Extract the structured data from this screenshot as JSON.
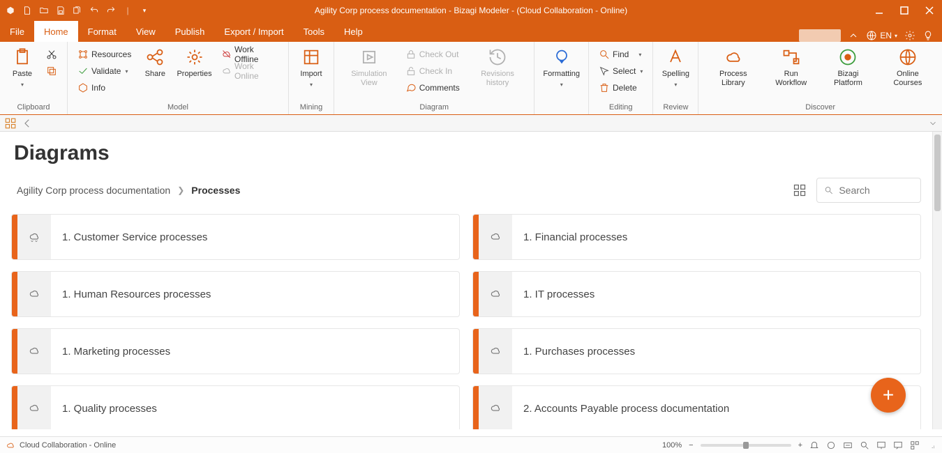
{
  "title": "Agility Corp process documentation - Bizagi Modeler - (Cloud Collaboration - Online)",
  "language": "EN",
  "tabs": {
    "file": "File",
    "home": "Home",
    "format": "Format",
    "view": "View",
    "publish": "Publish",
    "export": "Export / Import",
    "tools": "Tools",
    "help": "Help"
  },
  "ribbon": {
    "clipboard": {
      "paste": "Paste",
      "label": "Clipboard"
    },
    "model": {
      "resources": "Resources",
      "validate": "Validate",
      "info": "Info",
      "share": "Share",
      "properties": "Properties",
      "work_offline": "Work Offline",
      "work_online": "Work Online",
      "label": "Model"
    },
    "mining": {
      "import": "Import",
      "label": "Mining"
    },
    "diagram": {
      "simulation": "Simulation View",
      "checkout": "Check Out",
      "checkin": "Check In",
      "comments": "Comments",
      "history": "Revisions history",
      "label": "Diagram"
    },
    "formatting": {
      "formatting": "Formatting",
      "label": ""
    },
    "editing": {
      "find": "Find",
      "select": "Select",
      "delete": "Delete",
      "label": "Editing"
    },
    "review": {
      "spelling": "Spelling",
      "label": "Review"
    },
    "discover": {
      "library": "Process Library",
      "workflow": "Run Workflow",
      "platform": "Bizagi Platform",
      "courses": "Online Courses",
      "label": "Discover"
    }
  },
  "page": {
    "heading": "Diagrams",
    "breadcrumb_root": "Agility Corp process documentation",
    "breadcrumb_current": "Processes",
    "search_placeholder": "Search"
  },
  "cards": [
    {
      "title": "1. Customer Service processes"
    },
    {
      "title": "1. Financial processes"
    },
    {
      "title": "1. Human Resources processes"
    },
    {
      "title": "1. IT processes"
    },
    {
      "title": "1. Marketing processes"
    },
    {
      "title": "1. Purchases processes"
    },
    {
      "title": "1. Quality processes"
    },
    {
      "title": "2. Accounts Payable process documentation"
    }
  ],
  "status": {
    "text": "Cloud Collaboration - Online",
    "zoom": "100%"
  }
}
